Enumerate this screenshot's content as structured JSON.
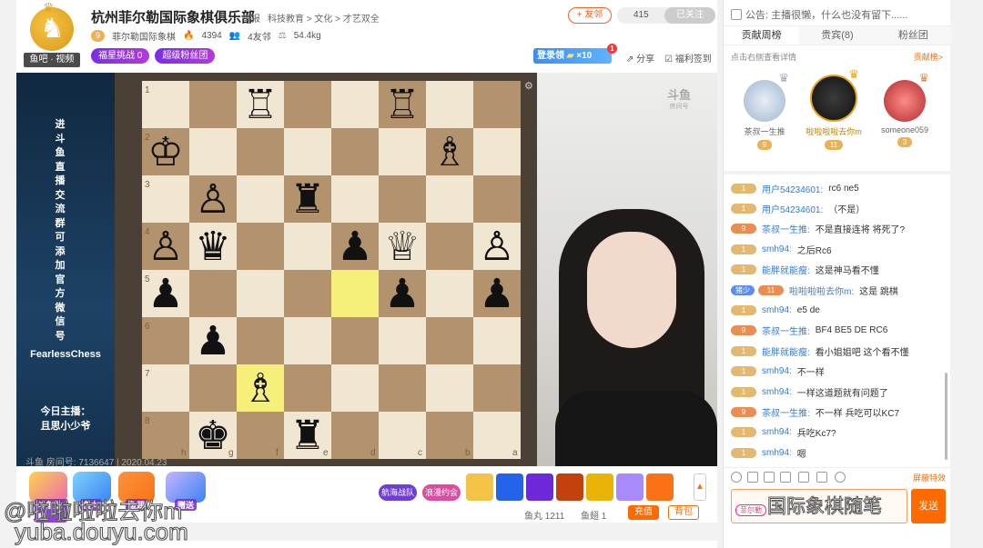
{
  "header": {
    "avatar_tag": "鱼吧 · 视频",
    "room_title": "杭州菲尔勒国际象棋俱乐部",
    "report": "举报",
    "category": "科技教育 > 文化 > 才艺双全",
    "fan_level": "9",
    "club_name": "菲尔勒国际象棋",
    "hot_value": "4394",
    "friends": "4友邻",
    "weight": "54.4kg",
    "promo_challenge": "福星挑战 0",
    "promo_fan_group": "超级粉丝团",
    "follow_button": "+ 友邻",
    "follow_count": "415",
    "followed_label": "已关注",
    "login_reward": "登录领",
    "login_reward_multiplier": "×10",
    "login_reward_dot": "1",
    "share": "分享",
    "welfare": "福利签到"
  },
  "player": {
    "side_vertical_text": "进斗鱼直播交流群可添加官方微信号",
    "side_fearless": "FearlessChess",
    "side_host_label": "今日主播：",
    "side_host_name": "且思小少爷",
    "cam_logo": "斗鱼",
    "cam_logo_sub": "房间号",
    "room_id_line": "斗鱼 房间号: 7136647 | 2020.04.23"
  },
  "board": {
    "rank_labels": [
      "1",
      "2",
      "3",
      "4",
      "5",
      "6",
      "7",
      "8"
    ],
    "file_labels": [
      "h",
      "g",
      "f",
      "e",
      "d",
      "c",
      "b",
      "a"
    ],
    "light_color": "#f0e6d2",
    "dark_color": "#b3926e",
    "highlight_color": "#f6f07a",
    "highlights": [
      [
        4,
        4
      ],
      [
        6,
        2
      ]
    ],
    "pieces": [
      {
        "row": 0,
        "col": 2,
        "glyph": "♖"
      },
      {
        "row": 0,
        "col": 5,
        "glyph": "♖"
      },
      {
        "row": 1,
        "col": 0,
        "glyph": "♔"
      },
      {
        "row": 1,
        "col": 6,
        "glyph": "♗"
      },
      {
        "row": 2,
        "col": 1,
        "glyph": "♙"
      },
      {
        "row": 2,
        "col": 3,
        "glyph": "♜"
      },
      {
        "row": 3,
        "col": 0,
        "glyph": "♙"
      },
      {
        "row": 3,
        "col": 1,
        "glyph": "♛"
      },
      {
        "row": 3,
        "col": 4,
        "glyph": "♟"
      },
      {
        "row": 3,
        "col": 5,
        "glyph": "♕"
      },
      {
        "row": 3,
        "col": 7,
        "glyph": "♙"
      },
      {
        "row": 4,
        "col": 0,
        "glyph": "♟"
      },
      {
        "row": 4,
        "col": 5,
        "glyph": "♟"
      },
      {
        "row": 4,
        "col": 7,
        "glyph": "♟"
      },
      {
        "row": 5,
        "col": 1,
        "glyph": "♟"
      },
      {
        "row": 6,
        "col": 2,
        "glyph": "♗"
      },
      {
        "row": 7,
        "col": 1,
        "glyph": "♚"
      },
      {
        "row": 7,
        "col": 3,
        "glyph": "♜"
      }
    ]
  },
  "gifts": {
    "caption_1": "斗鱼勋章",
    "caption_2": "鱼丸",
    "caption_3": "鱼翅",
    "caption_4": "赠送",
    "pill_navy": "航海战队",
    "pill_date": "浪漫约会",
    "fishball_label": "鱼丸 1211",
    "fishfin_label": "鱼翅 1",
    "recharge": "充值",
    "bag": "背包",
    "colors": [
      "#f3c247",
      "#2563eb",
      "#6d28d9",
      "#c2410c",
      "#eab308",
      "#a78bfa",
      "#f97316"
    ]
  },
  "watermark": {
    "name": "@啦啦啦啦去你m",
    "url": "yuba.douyu.com",
    "brand": "国际象棋随笔"
  },
  "right": {
    "notice": "公告: 主播很懒，什么也没有留下......",
    "tabs": [
      "贡献周榜",
      "贵宾(8)",
      "粉丝团"
    ],
    "rank_hint": "点击右侧查看详情",
    "rank_link": "贡献榜>",
    "top_users": [
      {
        "name": "茶叔一生推",
        "level": "9"
      },
      {
        "name": "啦啦啦啦去你m",
        "level": "11"
      },
      {
        "name": "someone059",
        "level": "3"
      }
    ],
    "chat": [
      {
        "level": "1",
        "user": "用户54234601:",
        "text": "rc6 ne5"
      },
      {
        "level": "1",
        "user": "用户54234601:",
        "text": "（不是）"
      },
      {
        "level": "9",
        "user": "茶叔一生推:",
        "text": "不是直接连将 将死了?"
      },
      {
        "level": "1",
        "user": "smh94:",
        "text": "之后Rc6"
      },
      {
        "level": "1",
        "user": "能胖就能瘦:",
        "text": "这是神马看不懂"
      },
      {
        "level": "11",
        "user": "啦啦啦啦去你m:",
        "text": "这是 跳棋",
        "fan": "猪少"
      },
      {
        "level": "1",
        "user": "smh94:",
        "text": "e5 de"
      },
      {
        "level": "9",
        "user": "茶叔一生推:",
        "text": "BF4 BE5 DE RC6"
      },
      {
        "level": "1",
        "user": "能胖就能瘦:",
        "text": "看小姐姐吧 这个看不懂"
      },
      {
        "level": "1",
        "user": "smh94:",
        "text": "不一样"
      },
      {
        "level": "1",
        "user": "smh94:",
        "text": "一样这道题就有问题了"
      },
      {
        "level": "9",
        "user": "茶叔一生推:",
        "text": "不一样 兵吃可以KC7"
      },
      {
        "level": "1",
        "user": "smh94:",
        "text": "兵吃Kc7?"
      },
      {
        "level": "1",
        "user": "smh94:",
        "text": "嗯"
      }
    ],
    "block_effects": "屏蔽特效",
    "input_badge": "菲尔勒",
    "send": "发送"
  }
}
